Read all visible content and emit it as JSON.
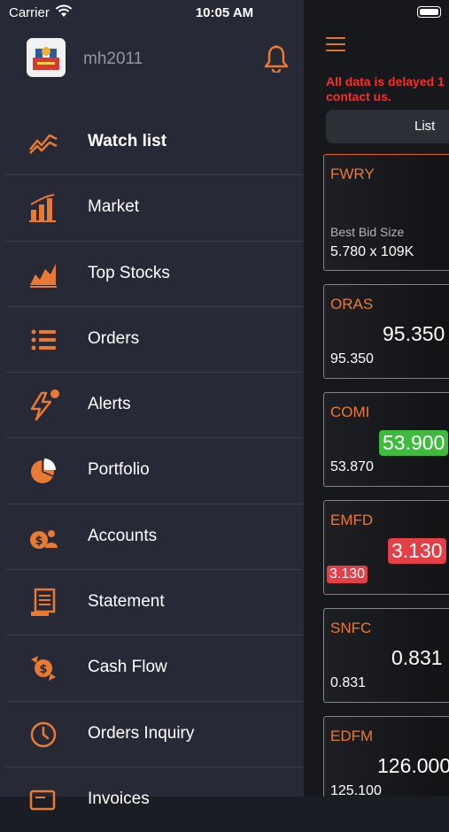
{
  "status_bar": {
    "carrier": "Carrier",
    "time": "10:05 AM"
  },
  "drawer": {
    "username": "mh2011",
    "menu": [
      {
        "label": "Watch list",
        "icon": "watchlist-chart-icon",
        "active": true
      },
      {
        "label": "Market",
        "icon": "market-bar-chart-icon"
      },
      {
        "label": "Top Stocks",
        "icon": "top-stocks-icon"
      },
      {
        "label": "Orders",
        "icon": "orders-list-icon"
      },
      {
        "label": "Alerts",
        "icon": "alerts-lightning-icon"
      },
      {
        "label": "Portfolio",
        "icon": "portfolio-pie-icon"
      },
      {
        "label": "Accounts",
        "icon": "accounts-icon"
      },
      {
        "label": "Statement",
        "icon": "statement-icon"
      },
      {
        "label": "Cash Flow",
        "icon": "cash-flow-icon"
      },
      {
        "label": "Orders Inquiry",
        "icon": "clock-icon"
      },
      {
        "label": "Invoices",
        "icon": "invoices-icon"
      }
    ]
  },
  "main": {
    "warning": "All data is delayed 1\ncontact us.",
    "segment_label": "List",
    "cards": [
      {
        "symbol": "FWRY",
        "bid_label": "Best Bid Size",
        "bid_value": "5.780 x 109K"
      },
      {
        "symbol": "ORAS",
        "price": "95.350",
        "last": "95.350",
        "trend": "neutral"
      },
      {
        "symbol": "COMI",
        "price": "53.900",
        "last": "53.870",
        "trend": "up"
      },
      {
        "symbol": "EMFD",
        "price": "3.130",
        "last": "3.130",
        "trend": "down"
      },
      {
        "symbol": "SNFC",
        "price": "0.831",
        "last": "0.831",
        "trend": "neutral"
      },
      {
        "symbol": "EDFM",
        "price": "126.000",
        "last": "125.100",
        "trend": "neutral"
      }
    ]
  },
  "colors": {
    "accent": "#e87a33",
    "drawer_bg": "#272a36",
    "up": "#3fba3f",
    "down": "#e33f47",
    "warning": "#ff2a2a",
    "snfc_border": "#3fba3f"
  }
}
